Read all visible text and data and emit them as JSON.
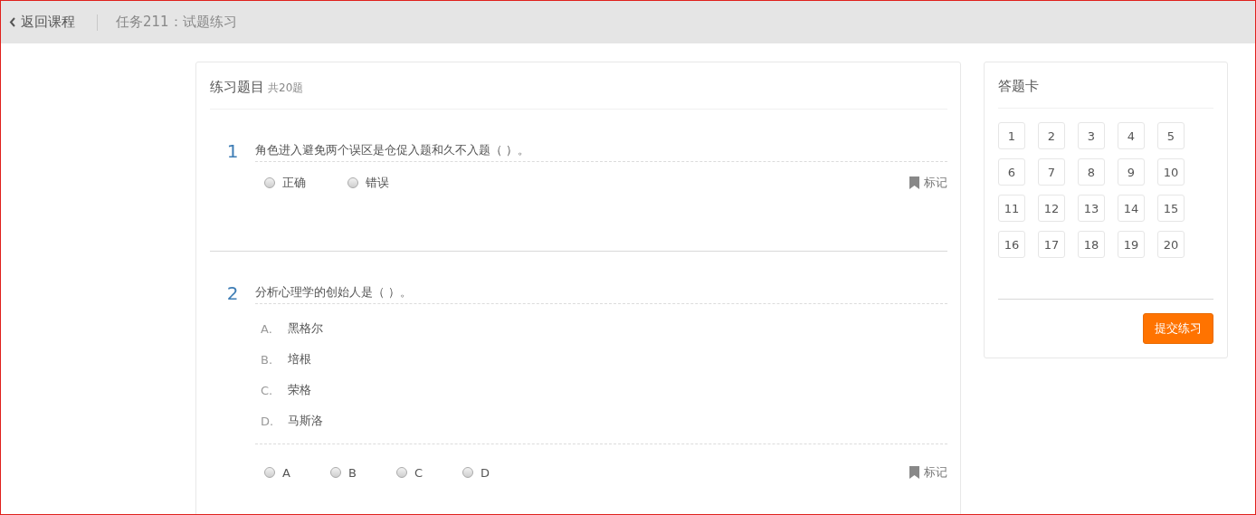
{
  "header": {
    "back_link": "返回课程",
    "title": "任务211：试题练习"
  },
  "practice": {
    "title": "练习题目",
    "count": "共20题",
    "questions": [
      {
        "kind": "judge",
        "number": "1",
        "text": "角色进入避免两个误区是仓促入题和久不入题（  ）。",
        "choices": [
          {
            "label": "正确",
            "selected": false
          },
          {
            "label": "错误",
            "selected": false
          }
        ],
        "mark": "标记"
      },
      {
        "kind": "single",
        "number": "2",
        "text": "分析心理学的创始人是（  ）。",
        "options": [
          {
            "letter": "A.",
            "text": "黑格尔"
          },
          {
            "letter": "B.",
            "text": "培根"
          },
          {
            "letter": "C.",
            "text": "荣格"
          },
          {
            "letter": "D.",
            "text": "马斯洛"
          }
        ],
        "choices": [
          {
            "label": "A",
            "selected": false
          },
          {
            "label": "B",
            "selected": false
          },
          {
            "label": "C",
            "selected": false
          },
          {
            "label": "D",
            "selected": false
          }
        ],
        "mark": "标记"
      }
    ]
  },
  "answer_card": {
    "title": "答题卡",
    "numbers": [
      "1",
      "2",
      "3",
      "4",
      "5",
      "6",
      "7",
      "8",
      "9",
      "10",
      "11",
      "12",
      "13",
      "14",
      "15",
      "16",
      "17",
      "18",
      "19",
      "20"
    ],
    "submit": "提交练习"
  }
}
